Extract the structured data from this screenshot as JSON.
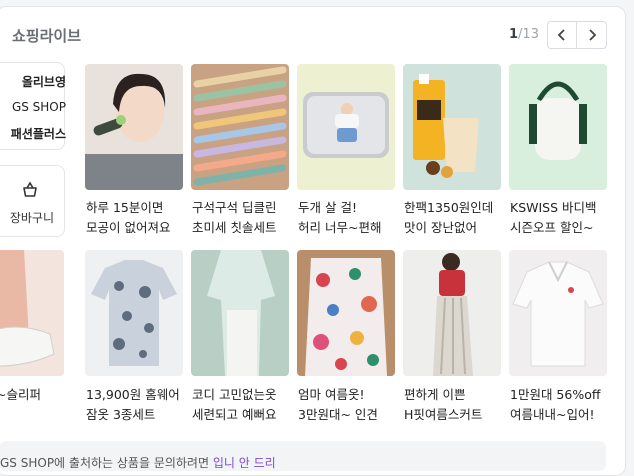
{
  "header": {
    "title": "쇼핑라이브",
    "page_current": "1",
    "page_total": "/13",
    "prev_icon": "chevron-left-icon",
    "next_icon": "chevron-right-icon"
  },
  "sidebar": {
    "brands": [
      "올리브영",
      "GS SHOP",
      "패션플러스"
    ],
    "cart_label": "장바구니",
    "cart_icon": "shopping-basket-icon"
  },
  "row1": [
    {
      "line1": "하루 15분이면",
      "line2": "모공이 없어져요"
    },
    {
      "line1": "구석구석 딥클린",
      "line2": "초미세 칫솔세트"
    },
    {
      "line1": "두개 살 걸!",
      "line2": "허리 너무~편해"
    },
    {
      "line1": "한팩1350원인데",
      "line2": "맛이 장난없어"
    },
    {
      "line1": "KSWISS 바디백",
      "line2": "시즌오프 할인~"
    }
  ],
  "row2": [
    {
      "line1": "",
      "line2": "~슬리퍼"
    },
    {
      "line1": "13,900원 홈웨어",
      "line2": "잠옷 3종세트"
    },
    {
      "line1": "코디 고민없는옷",
      "line2": "세련되고 예뻐요"
    },
    {
      "line1": "엄마 여름옷!",
      "line2": "3만원대~ 인견"
    },
    {
      "line1": "편하게 이쁜",
      "line2": "H핏여름스커트"
    },
    {
      "line1": "1만원대 56%off",
      "line2": "여름내내~입어!"
    }
  ],
  "notice": {
    "text": "GS SHOP에 출처하는 상품을 문의하려면 ",
    "link": "입니 안 드리"
  },
  "colors": {
    "accent": "#7b4bd6",
    "title": "#6b6f75"
  }
}
